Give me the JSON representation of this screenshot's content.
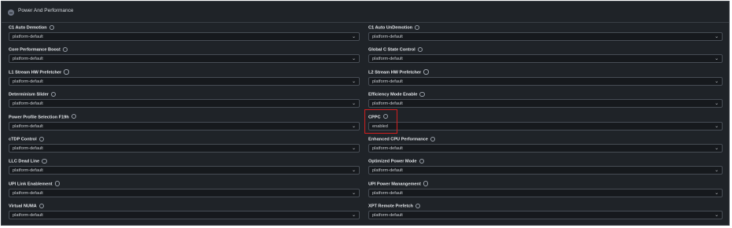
{
  "section": {
    "title": "Power And Performance"
  },
  "left": [
    {
      "label": "C1 Auto Demotion",
      "value": "platform-default"
    },
    {
      "label": "Core Performance Boost",
      "value": "platform-default"
    },
    {
      "label": "L1 Stream HW Prefetcher",
      "value": "platform-default"
    },
    {
      "label": "Determinism Slider",
      "value": "platform-default"
    },
    {
      "label": "Power Profile Selection F19h",
      "value": "platform-default"
    },
    {
      "label": "cTDP Control",
      "value": "platform-default"
    },
    {
      "label": "LLC Dead Line",
      "value": "platform-default"
    },
    {
      "label": "UPI Link Enablement",
      "value": "platform-default"
    },
    {
      "label": "Virtual NUMA",
      "value": "platform-default"
    }
  ],
  "right": [
    {
      "label": "C1 Auto UnDemotion",
      "value": "platform-default"
    },
    {
      "label": "Global C State Control",
      "value": "platform-default"
    },
    {
      "label": "L2 Stream HW Prefetcher",
      "value": "platform-default"
    },
    {
      "label": "Efficiency Mode Enable",
      "value": "platform-default"
    },
    {
      "label": "CPPC",
      "value": "enabled"
    },
    {
      "label": "Enhanced CPU Performance",
      "value": "platform-default"
    },
    {
      "label": "Optimized Power Mode",
      "value": "platform-default"
    },
    {
      "label": "UPI Power Manangement",
      "value": "platform-default"
    },
    {
      "label": "XPT Remote Prefetch",
      "value": "platform-default"
    }
  ],
  "icons": {
    "info": "info-icon",
    "chevron": "chevron-down-icon",
    "collapse": "collapse-icon"
  },
  "colors": {
    "highlight": "#d11f1f",
    "background": "#1f2328"
  }
}
